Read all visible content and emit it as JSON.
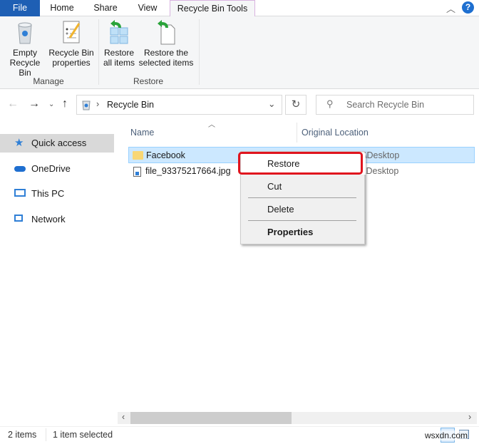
{
  "tabs": [
    "File",
    "Home",
    "Share",
    "View",
    "Recycle Bin Tools"
  ],
  "ribbon": {
    "groups": [
      {
        "label": "Manage",
        "buttons": [
          [
            "Empty",
            "Recycle Bin"
          ],
          [
            "Recycle Bin",
            "properties"
          ]
        ]
      },
      {
        "label": "Restore",
        "buttons": [
          [
            "Restore",
            "all items"
          ],
          [
            "Restore the",
            "selected items"
          ]
        ]
      }
    ]
  },
  "address": {
    "path": "Recycle Bin",
    "search_placeholder": "Search Recycle Bin"
  },
  "sidebar": {
    "items": [
      "Quick access",
      "OneDrive",
      "This PC",
      "Network"
    ]
  },
  "columns": [
    "Name",
    "Original Location"
  ],
  "files": [
    {
      "name": "Facebook",
      "location": "\\Desktop",
      "type": "folder",
      "selected": true
    },
    {
      "name": "file_93375217664.jpg",
      "location": "\\Desktop",
      "type": "image",
      "selected": false
    }
  ],
  "context_menu": {
    "items": [
      "Restore",
      "Cut",
      "Delete",
      "Properties"
    ],
    "highlight_color": "#e0141e"
  },
  "status": {
    "count": "2 items",
    "selection": "1 item selected"
  },
  "watermark": "wsxdn.com",
  "colors": {
    "file_tab": "#1e5fb4",
    "selection": "#cce8ff",
    "context_tab_border": "#d9b3e0"
  }
}
